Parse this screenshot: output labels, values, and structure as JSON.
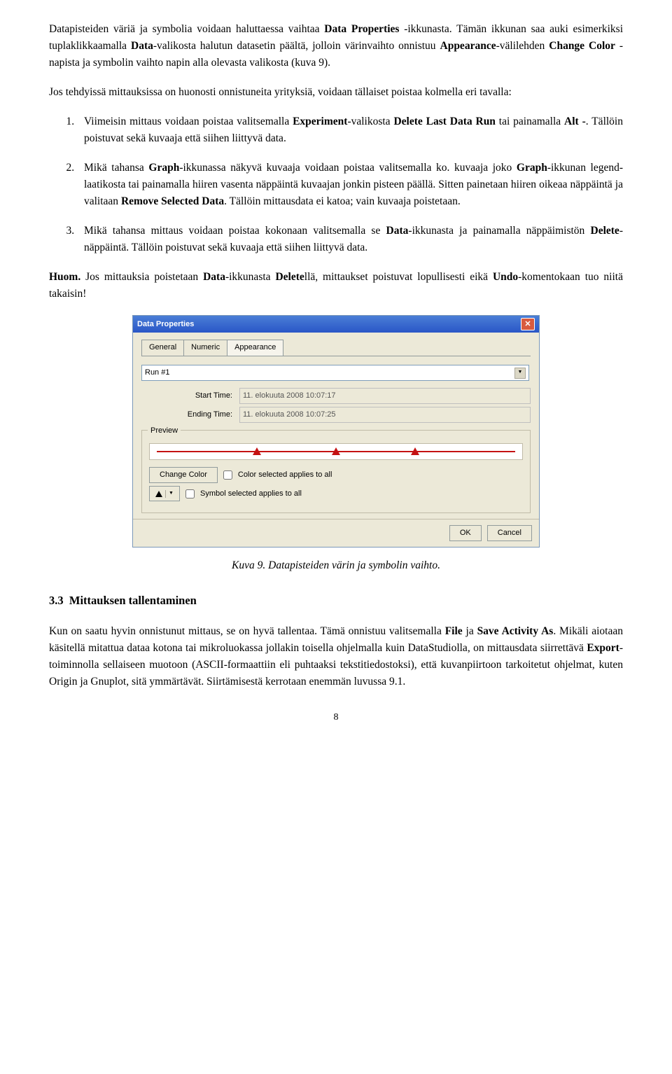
{
  "paragraphs": {
    "p1a": "Datapisteiden väriä ja symbolia voidaan haluttaessa vaihtaa ",
    "p1b": "Data Properties",
    "p1c": " -ikkunasta. Tämän ikkunan saa auki esimerkiksi tuplaklikkaamalla ",
    "p1d": "Data",
    "p1e": "-valikosta halutun datasetin päältä, jolloin värinvaihto onnistuu ",
    "p1f": "Appearance",
    "p1g": "-välilehden ",
    "p1h": "Change Color",
    "p1i": " -napista ja symbolin vaihto napin alla olevasta valikosta (kuva 9).",
    "p2": "Jos tehdyissä mittauksissa on huonosti onnistuneita yrityksiä, voidaan tällaiset poistaa kolmella eri tavalla:",
    "li1a": "Viimeisin mittaus voidaan poistaa valitsemalla ",
    "li1b": "Experiment",
    "li1c": "-valikosta ",
    "li1d": "Delete Last Data Run",
    "li1e": " tai painamalla ",
    "li1f": "Alt -",
    "li1g": ". Tällöin poistuvat sekä kuvaaja että siihen liittyvä data.",
    "li2a": "Mikä tahansa ",
    "li2b": "Graph",
    "li2c": "-ikkunassa näkyvä kuvaaja voidaan poistaa valitsemalla ko. kuvaaja joko ",
    "li2d": "Graph",
    "li2e": "-ikkunan legend-laatikosta tai painamalla hiiren vasenta näppäintä kuvaajan jonkin pisteen päällä. Sitten painetaan hiiren oikeaa näppäintä ja valitaan ",
    "li2f": "Remove Selected Data",
    "li2g": ". Tällöin mittausdata ei katoa; vain kuvaaja poistetaan.",
    "li3a": "Mikä tahansa mittaus voidaan poistaa kokonaan valitsemalla se ",
    "li3b": "Data",
    "li3c": "-ikkunasta ja painamalla näppäimistön ",
    "li3d": "Delete",
    "li3e": "-näppäintä. Tällöin poistuvat sekä kuvaaja että siihen liittyvä data.",
    "noteA": "Huom.",
    "noteB": " Jos mittauksia poistetaan ",
    "noteC": "Data",
    "noteD": "-ikkunasta ",
    "noteE": "Delete",
    "noteF": "llä, mittaukset poistuvat lopullisesti eikä ",
    "noteG": "Undo",
    "noteH": "-komentokaan tuo niitä takaisin!",
    "caption": "Kuva 9. Datapisteiden värin ja symbolin vaihto.",
    "sectionNum": "3.3",
    "sectionTitle": "Mittauksen tallentaminen",
    "p3a": "Kun on saatu hyvin onnistunut mittaus, se on hyvä tallentaa. Tämä onnistuu valitsemalla ",
    "p3b": "File",
    "p3c": " ja ",
    "p3d": "Save Activity As",
    "p3e": ". Mikäli aiotaan käsitellä mitattua dataa kotona tai mikroluokassa jollakin toisella ohjelmalla kuin DataStudiolla, on mittausdata siirrettävä ",
    "p3f": "Export",
    "p3g": "-toiminnolla sellaiseen muotoon (ASCII-formaattiin eli puhtaaksi tekstitiedostoksi), että kuvanpiirtoon tarkoitetut ohjelmat, kuten Origin ja Gnuplot, sitä ymmärtävät. Siirtämisestä kerrotaan enemmän luvussa 9.1.",
    "pageNumber": "8"
  },
  "dialog": {
    "title": "Data Properties",
    "tabs": [
      "General",
      "Numeric",
      "Appearance"
    ],
    "activeTab": "Appearance",
    "runSelect": "Run #1",
    "startLabel": "Start Time:",
    "startVal": "11. elokuuta 2008 10:07:17",
    "endLabel": "Ending Time:",
    "endVal": "11. elokuuta 2008 10:07:25",
    "previewTitle": "Preview",
    "changeColor": "Change Color",
    "colorCheck": "Color selected applies to all",
    "symbolCheck": "Symbol selected applies to all",
    "ok": "OK",
    "cancel": "Cancel"
  }
}
